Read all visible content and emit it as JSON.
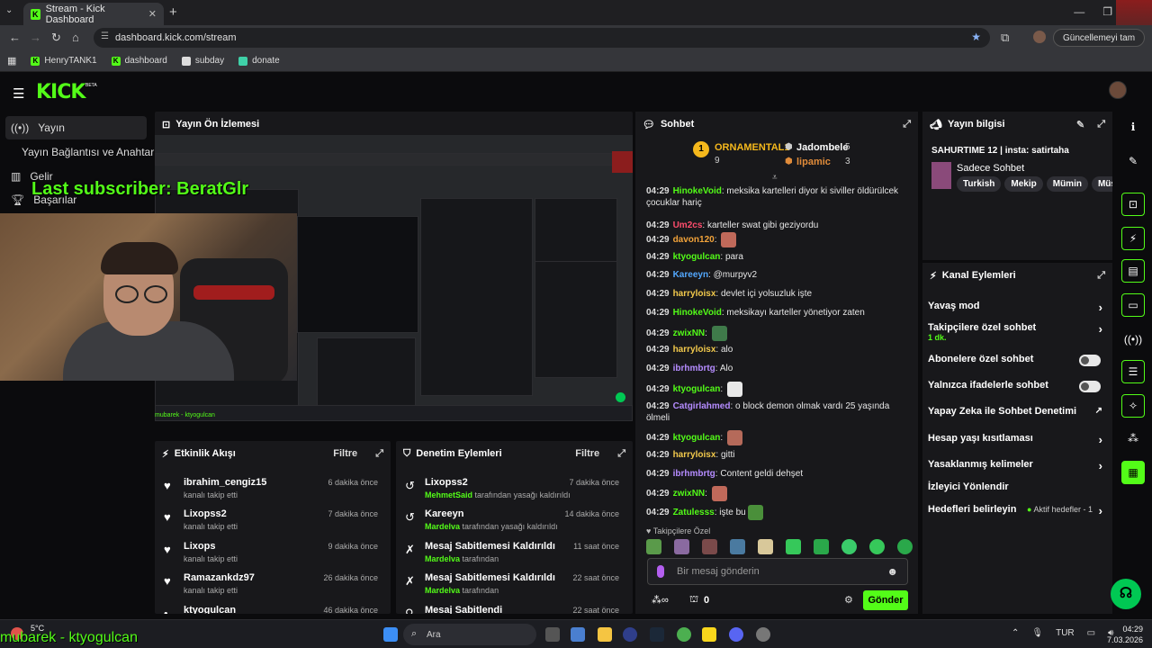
{
  "browser": {
    "tab_title": "Stream - Kick Dashboard",
    "url": "dashboard.kick.com/stream",
    "update_label": "Güncellemeyi tam",
    "bookmarks": [
      "HenryTANK1",
      "dashboard",
      "subday",
      "donate"
    ]
  },
  "app": {
    "logo": "KICK",
    "beta": "BETA"
  },
  "leftnav": {
    "items": [
      "Yayın",
      "Yayın Bağlantısı ve Anahtarı",
      "Gelir",
      "Başarılar"
    ]
  },
  "overlay": {
    "last_subscriber": "Last subscriber: BeratGlr",
    "bottom_text": "mubarek - ktyogulcan"
  },
  "preview": {
    "title": "Yayın Ön İzlemesi",
    "mini_overlay": "mubarek - ktyogulcan"
  },
  "activity": {
    "title": "Etkinlik Akışı",
    "filter": "Filtre",
    "items": [
      {
        "name": "ibrahim_cengiz15",
        "sub": "kanalı takip etti",
        "time": "6 dakika önce"
      },
      {
        "name": "Lixopss2",
        "sub": "kanalı takip etti",
        "time": "7 dakika önce"
      },
      {
        "name": "Lixops",
        "sub": "kanalı takip etti",
        "time": "9 dakika önce"
      },
      {
        "name": "Ramazankdz97",
        "sub": "kanalı takip etti",
        "time": "26 dakika önce"
      },
      {
        "name": "ktyogulcan",
        "sub": "",
        "time": "46 dakika önce"
      }
    ]
  },
  "moderation": {
    "title": "Denetim Eylemleri",
    "filter": "Filtre",
    "items": [
      {
        "name": "Lixopss2",
        "by": "MehmetSaid",
        "sub": "tarafından yasağı kaldırıldı",
        "time": "7 dakika önce"
      },
      {
        "name": "Kareeyn",
        "by": "Mardelva",
        "sub": "tarafından yasağı kaldırıldı",
        "time": "14 dakika önce"
      },
      {
        "name": "Mesaj Sabitlemesi Kaldırıldı",
        "by": "Mardelva",
        "sub": "tarafından",
        "time": "11 saat önce"
      },
      {
        "name": "Mesaj Sabitlemesi Kaldırıldı",
        "by": "Mardelva",
        "sub": "tarafından",
        "time": "22 saat önce"
      },
      {
        "name": "Mesaj Sabitlendi",
        "by": "",
        "sub": "",
        "time": "22 saat önce"
      }
    ]
  },
  "chat": {
    "title": "Sohbet",
    "leaders": [
      {
        "rank": "1",
        "name": "ORNAMENTAL1",
        "count": "9"
      },
      {
        "name": "Jadombele",
        "count": "5"
      },
      {
        "name": "lipamic",
        "count": "3"
      }
    ],
    "messages": [
      {
        "time": "04:29",
        "user": "HinokeVoid",
        "color": "#53fc18",
        "text": "meksika kartelleri diyor ki siviller öldürülcek çocuklar hariç"
      },
      {
        "time": "04:29",
        "user": "Um2cs",
        "color": "#ff4d6d",
        "text": "karteller swat gibi geziyordu"
      },
      {
        "time": "04:29",
        "user": "davon120",
        "color": "#f2a33a",
        "text": ""
      },
      {
        "time": "04:29",
        "user": "ktyogulcan",
        "color": "#53fc18",
        "text": "para"
      },
      {
        "time": "04:29",
        "user": "Kareeyn",
        "color": "#53a8ff",
        "text": "@murpyv2"
      },
      {
        "time": "04:29",
        "user": "harryloisx",
        "color": "#f2c94c",
        "text": "devlet içi yolsuzluk işte"
      },
      {
        "time": "04:29",
        "user": "HinokeVoid",
        "color": "#53fc18",
        "text": "meksikayı karteller yönetiyor zaten"
      },
      {
        "time": "04:29",
        "user": "zwixNN",
        "color": "#53fc18",
        "text": ""
      },
      {
        "time": "04:29",
        "user": "harryloisx",
        "color": "#f2c94c",
        "text": "alo"
      },
      {
        "time": "04:29",
        "user": "ibrhmbrtg",
        "color": "#b58cff",
        "text": "Alo"
      },
      {
        "time": "04:29",
        "user": "ktyogulcan",
        "color": "#53fc18",
        "text": ""
      },
      {
        "time": "04:29",
        "user": "Catgirlahmed",
        "color": "#b58cff",
        "text": "o block demon olmak vardı 25 yaşında ölmeli"
      },
      {
        "time": "04:29",
        "user": "ktyogulcan",
        "color": "#53fc18",
        "text": ""
      },
      {
        "time": "04:29",
        "user": "harryloisx",
        "color": "#f2c94c",
        "text": "gitti"
      },
      {
        "time": "04:29",
        "user": "ibrhmbrtg",
        "color": "#b58cff",
        "text": "Content geldi dehşet"
      },
      {
        "time": "04:29",
        "user": "zwixNN",
        "color": "#53fc18",
        "text": ""
      },
      {
        "time": "04:29",
        "user": "Zatulesss",
        "color": "#53fc18",
        "text": "işte bu"
      }
    ],
    "emote_section": "Takipçilere Özel",
    "placeholder": "Bir mesaj gönderin",
    "points": "0",
    "send": "Gönder"
  },
  "info": {
    "title": "Yayın bilgisi",
    "stream_title": "SAHURTIME 12 | insta: satirtaha",
    "category": "Sadece Sohbet",
    "tags": [
      "Turkish",
      "Mekip",
      "Mümin",
      "Müs"
    ]
  },
  "actions": {
    "title": "Kanal Eylemleri",
    "slow": "Yavaş mod",
    "followers": "Takipçilere özel sohbet",
    "followers_sub": "1 dk.",
    "subs": "Abonelere özel sohbet",
    "emotes": "Yalnızca ifadelerle sohbet",
    "ai": "Yapay Zeka ile Sohbet Denetimi",
    "age": "Hesap yaşı kısıtlaması",
    "banned": "Yasaklanmış kelimeler",
    "redirect": "İzleyici Yönlendir",
    "goals": "Hedefleri belirleyin",
    "goals_status": "Aktif hedefler - 1"
  },
  "taskbar": {
    "weather": "5°C",
    "search": "Ara",
    "lang": "TUR",
    "time": "04:29",
    "date": "7.03.2026"
  },
  "colors": {
    "accent": "#53fc18",
    "panel": "#18181b",
    "bg": "#0b0b0d"
  }
}
